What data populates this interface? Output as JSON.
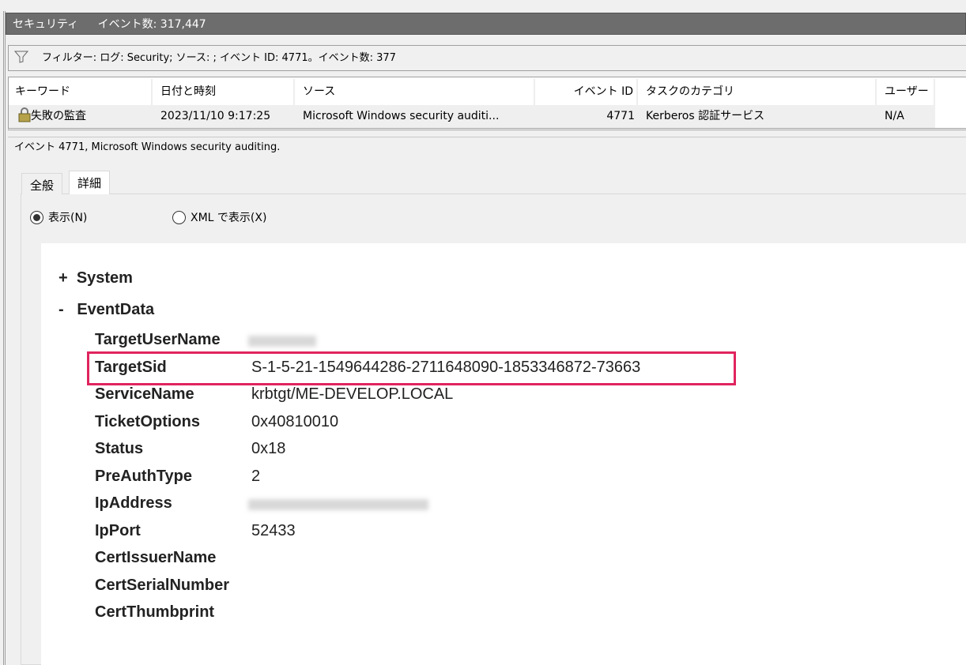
{
  "title_bar": {
    "log_name": "セキュリティ",
    "event_count": "イベント数: 317,447"
  },
  "filter": {
    "text": "フィルター: ログ: Security; ソース: ; イベント ID: 4771。イベント数: 377",
    "icon": "filter-icon"
  },
  "table": {
    "columns": [
      "キーワード",
      "日付と時刻",
      "ソース",
      "イベント ID",
      "タスクのカテゴリ",
      "ユーザー"
    ],
    "rows": [
      {
        "keyword": "失敗の監査",
        "date": "2023/11/10 9:17:25",
        "source": "Microsoft Windows security auditi...",
        "event_id": "4771",
        "category": "Kerberos 認証サービス",
        "user": "N/A",
        "icon": "lock-icon"
      }
    ]
  },
  "event_header": "イベント 4771, Microsoft Windows security auditing.",
  "tabs": [
    "全般",
    "詳細"
  ],
  "active_tab": "詳細",
  "view_options": {
    "friendly": "表示(N)",
    "xml": "XML で表示(X)",
    "selected": "friendly"
  },
  "tree": {
    "system": {
      "toggle": "+",
      "label": "System"
    },
    "eventdata": {
      "toggle": "-",
      "label": "EventData"
    },
    "fields": [
      {
        "key": "TargetUserName",
        "value": null
      },
      {
        "key": "TargetSid",
        "value": "S-1-5-21-1549644286-2711648090-1853346872-73663"
      },
      {
        "key": "ServiceName",
        "value": "krbtgt/ME-DEVELOP.LOCAL"
      },
      {
        "key": "TicketOptions",
        "value": "0x40810010"
      },
      {
        "key": "Status",
        "value": "0x18"
      },
      {
        "key": "PreAuthType",
        "value": "2"
      },
      {
        "key": "IpAddress",
        "value": null
      },
      {
        "key": "IpPort",
        "value": "52433"
      },
      {
        "key": "CertIssuerName",
        "value": ""
      },
      {
        "key": "CertSerialNumber",
        "value": ""
      },
      {
        "key": "CertThumbprint",
        "value": ""
      }
    ]
  },
  "colors": {
    "highlight": "#e0245e",
    "title_bar": "#6d6d6d"
  }
}
